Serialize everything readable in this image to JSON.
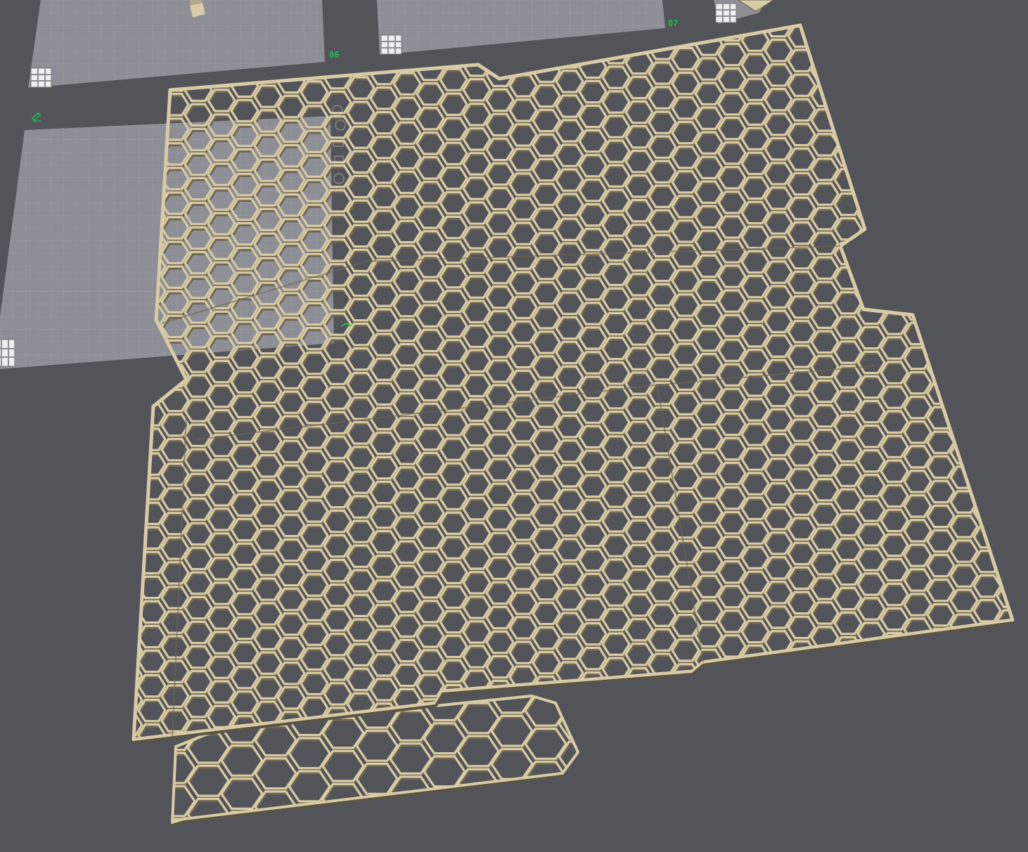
{
  "viewport": {
    "background": "#53535a",
    "plate_color": "#8d8e96",
    "grid_color": "#9fa0a8",
    "honeycomb_color": "#d8cba5",
    "honeycomb_shadow": "#6e6650",
    "label_color": "#19c24a"
  },
  "plates": [
    {
      "label": "06",
      "icon": "plate-grid-icon"
    },
    {
      "label": "07",
      "icon": "plate-grid-icon"
    },
    {
      "label": "",
      "icon": "plate-grid-icon",
      "edit_icon": "pencil-icon"
    }
  ],
  "model": {
    "name": "honeycomb-panels",
    "parts": [
      "top-left-panel",
      "top-right-panel",
      "middle-panel",
      "right-panel",
      "bottom-left-panel",
      "bottom-strip"
    ]
  }
}
